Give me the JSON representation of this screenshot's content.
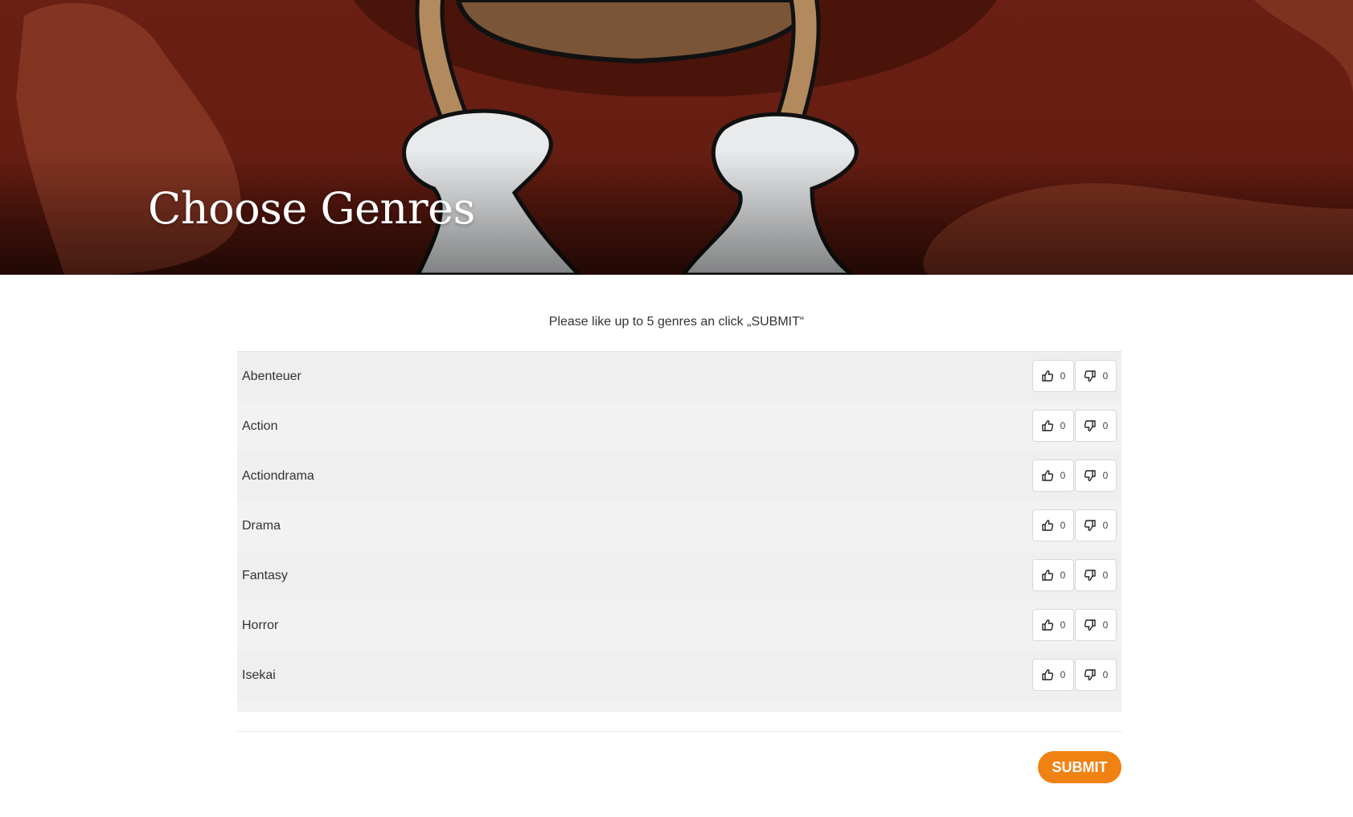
{
  "header": {
    "title": "Choose Genres"
  },
  "intro": {
    "text": "Please like up to 5 genres an click „SUBMIT“"
  },
  "genres": [
    {
      "name": "Abenteuer",
      "likes": "0",
      "dislikes": "0"
    },
    {
      "name": "Action",
      "likes": "0",
      "dislikes": "0"
    },
    {
      "name": "Actiondrama",
      "likes": "0",
      "dislikes": "0"
    },
    {
      "name": "Drama",
      "likes": "0",
      "dislikes": "0"
    },
    {
      "name": "Fantasy",
      "likes": "0",
      "dislikes": "0"
    },
    {
      "name": "Horror",
      "likes": "0",
      "dislikes": "0"
    },
    {
      "name": "Isekai",
      "likes": "0",
      "dislikes": "0"
    }
  ],
  "footer": {
    "submit_label": "SUBMIT"
  },
  "icons": {
    "like": "thumbs-up-icon",
    "dislike": "thumbs-down-icon"
  },
  "colors": {
    "hero_bg": "#6a1f14",
    "accent": "#f08214",
    "panel_bg": "#f1f1f1"
  }
}
